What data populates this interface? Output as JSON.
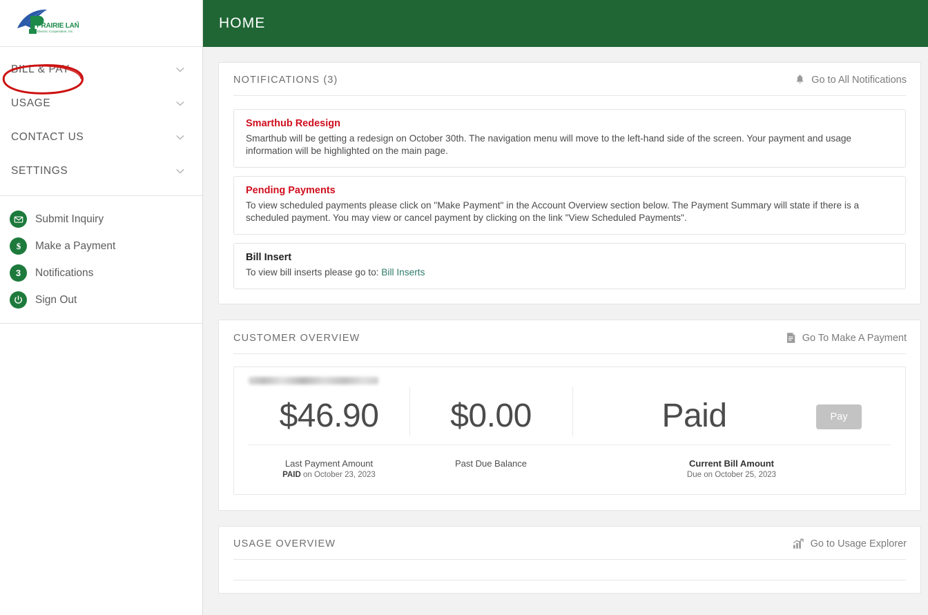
{
  "brand": {
    "name": "PRAIRIE LAND",
    "tagline": "Electric Cooperative, Inc.",
    "logo_blue": "#2b5aa8",
    "logo_green": "#1d8a4a"
  },
  "theme": {
    "header_green": "#1f6634",
    "icon_green": "#1d7a3c",
    "alert_red": "#d00f1e",
    "link_teal": "#2e7b68",
    "annotation_red": "#cc1111",
    "disabled_gray": "#c3c3c3"
  },
  "header": {
    "title": "HOME"
  },
  "sidebar": {
    "nav_items": [
      {
        "label": "BILL & PAY",
        "icon": "chevron-down-icon",
        "annotated": true
      },
      {
        "label": "USAGE",
        "icon": "chevron-down-icon",
        "annotated": false
      },
      {
        "label": "CONTACT US",
        "icon": "chevron-down-icon",
        "annotated": false
      },
      {
        "label": "SETTINGS",
        "icon": "chevron-down-icon",
        "annotated": false
      }
    ],
    "quick_items": [
      {
        "label": "Submit Inquiry",
        "icon": "envelope-icon"
      },
      {
        "label": "Make a Payment",
        "icon": "dollar-icon"
      },
      {
        "label": "Notifications",
        "icon": "notification-count-badge",
        "count": "3"
      },
      {
        "label": "Sign Out",
        "icon": "power-icon"
      }
    ]
  },
  "notifications_card": {
    "title": "NOTIFICATIONS (3)",
    "action_label": "Go to All Notifications",
    "action_icon": "bell-icon",
    "items": [
      {
        "title": "Smarthub Redesign",
        "title_color": "red",
        "body": "Smarthub will be getting a redesign on October 30th. The navigation menu will move to the left-hand side of the screen. Your payment and usage information will be highlighted on the main page."
      },
      {
        "title": "Pending Payments",
        "title_color": "red",
        "body": "To view scheduled payments please click on \"Make Payment\" in the Account Overview section below. The Payment Summary will state if there is a scheduled payment. You may view or cancel payment by clicking on the link \"View Scheduled Payments\"."
      },
      {
        "title": "Bill Insert",
        "title_color": "dark",
        "body_prefix": "To view bill inserts please go to: ",
        "body_link": "Bill Inserts"
      }
    ]
  },
  "customer_overview": {
    "title": "CUSTOMER OVERVIEW",
    "action_label": "Go To Make A Payment",
    "action_icon": "invoice-icon",
    "account_name_redacted": true,
    "columns": [
      {
        "value": "$46.90",
        "label": "Last Payment Amount",
        "sub_bold": "PAID",
        "sub_rest": " on October 23, 2023"
      },
      {
        "value": "$0.00",
        "label": "Past Due Balance",
        "sub_bold": "",
        "sub_rest": ""
      },
      {
        "value": "Paid",
        "label": "Current Bill Amount",
        "sub_bold": "",
        "sub_rest": "Due on October 25, 2023"
      }
    ],
    "pay_button": {
      "label": "Pay",
      "disabled": true
    }
  },
  "usage_overview": {
    "title": "USAGE OVERVIEW",
    "action_label": "Go to Usage Explorer",
    "action_icon": "bar-chart-up-icon"
  }
}
